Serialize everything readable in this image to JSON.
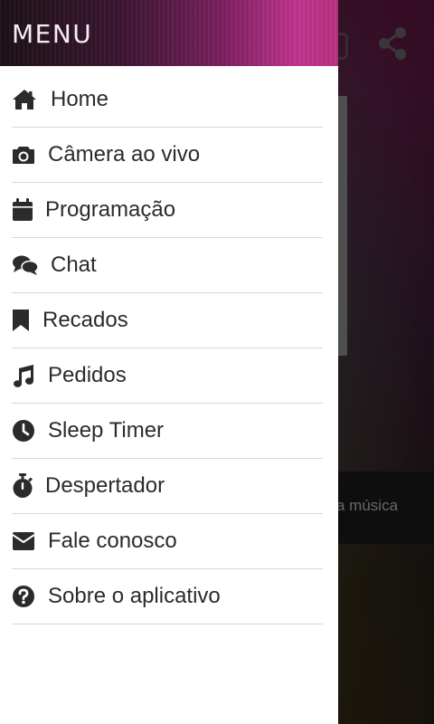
{
  "drawer": {
    "title": "MENU",
    "items": [
      {
        "label": "Home",
        "icon": "home-icon"
      },
      {
        "label": "Câmera ao vivo",
        "icon": "camera-icon"
      },
      {
        "label": "Programação",
        "icon": "calendar-icon"
      },
      {
        "label": "Chat",
        "icon": "chat-icon"
      },
      {
        "label": "Recados",
        "icon": "bookmark-icon"
      },
      {
        "label": "Pedidos",
        "icon": "music-note-icon"
      },
      {
        "label": "Sleep Timer",
        "icon": "clock-icon"
      },
      {
        "label": "Despertador",
        "icon": "stopwatch-icon"
      },
      {
        "label": "Fale conosco",
        "icon": "envelope-icon"
      },
      {
        "label": "Sobre o aplicativo",
        "icon": "question-circle-icon"
      }
    ]
  },
  "background": {
    "bar_text": "a música",
    "share_icon": "share-icon"
  },
  "colors": {
    "header_accent": "#c0348d",
    "text": "#2b2b2b",
    "divider": "#d8d8d8"
  }
}
